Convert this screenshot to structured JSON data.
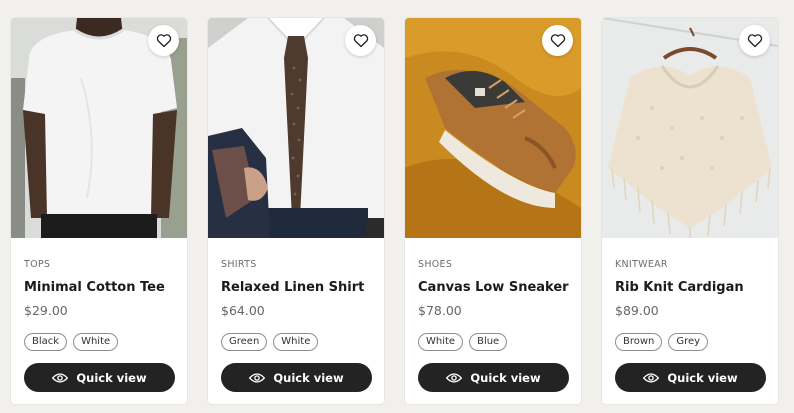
{
  "products": [
    {
      "category": "TOPS",
      "name": "Minimal Cotton Tee",
      "price": "$29.00",
      "colors": [
        "Black",
        "White"
      ],
      "quick_view": "Quick view",
      "image": "white-tshirt-photo"
    },
    {
      "category": "SHIRTS",
      "name": "Relaxed Linen Shirt",
      "price": "$64.00",
      "colors": [
        "Green",
        "White"
      ],
      "quick_view": "Quick view",
      "image": "dress-shirt-and-tie-photo"
    },
    {
      "category": "SHOES",
      "name": "Canvas Low Sneaker",
      "price": "$78.00",
      "colors": [
        "White",
        "Blue"
      ],
      "quick_view": "Quick view",
      "image": "tan-sneaker-photo"
    },
    {
      "category": "KNITWEAR",
      "name": "Rib Knit Cardigan",
      "price": "$89.00",
      "colors": [
        "Brown",
        "Grey"
      ],
      "quick_view": "Quick view",
      "image": "cream-knit-poncho-photo"
    }
  ],
  "icons": {
    "favorite": "heart-icon",
    "quick_view": "eye-icon"
  },
  "colors": {
    "page_background": "#f2f0ec",
    "card_background": "#ffffff",
    "button_background": "#232323",
    "button_text": "#ffffff"
  }
}
